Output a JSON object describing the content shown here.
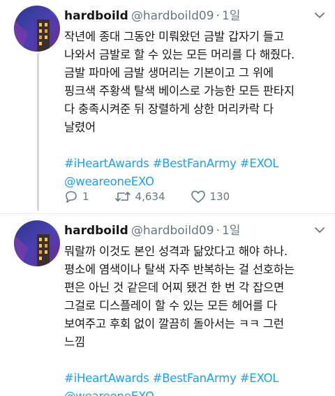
{
  "tweets": [
    {
      "display_name": "hardboild",
      "handle": "@hardboild09",
      "separator": "·",
      "time": "1일",
      "lines": [
        "작년에 종대 그동안 미뤄왔던 금발 갑자기 들고",
        "나와서 금발로 할 수 있는 모든 머리를 다 해줬다.",
        "금발 파마에 금발 생머리는 기본이고 그 위에",
        "핑크색 주황색 탈색 베이스로 가능한 모든 판타지",
        "다 충족시켜준 뒤 장렬하게 상한 머리카락 다",
        "날렸어"
      ],
      "hashtags_line": "#iHeartAwards #BestFanArmy #EXOL",
      "mention_line": "@weareoneEXO",
      "reply_count": "1",
      "retweet_count": "4,634",
      "like_count": "130"
    },
    {
      "display_name": "hardboild",
      "handle": "@hardboild09",
      "separator": "·",
      "time": "1일",
      "lines": [
        "뭐랄까 이것도 본인 성격과 닮았다고 해야 하나.",
        "평소에 염색이나 탈색 자주 반복하는 걸 선호하는",
        "편은 아닌 것 같은데 어찌 됐건 한 번 각 잡으면",
        "그걸로 디스플레이 할 수 있는 모든 헤어를 다",
        "보여주고 후회 없이 깔끔히 돌아서는 ㅋㅋ 그런",
        "느낌"
      ],
      "hashtags_line": "#iHeartAwards #BestFanArmy #EXOL",
      "mention_line": "@weareoneEXO"
    }
  ],
  "icons": {
    "reply": "reply-icon",
    "retweet": "retweet-icon",
    "like": "heart-icon",
    "caret": "chevron-down-icon",
    "avatar": "avatar-image"
  },
  "colors": {
    "text": "#14171a",
    "muted": "#657786",
    "link": "#1da1f2",
    "divider": "#e6ecf0",
    "thread_line": "#cfd9de"
  }
}
